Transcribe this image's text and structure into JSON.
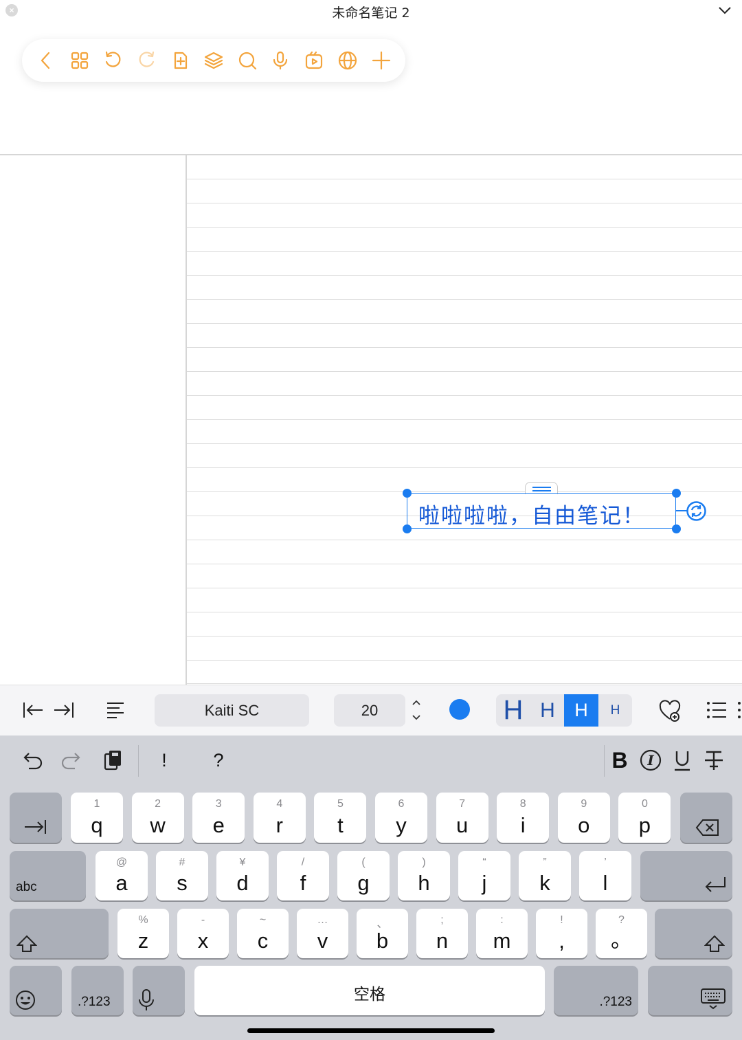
{
  "window": {
    "title": "未命名笔记 2"
  },
  "toolbar": {
    "icons": [
      "back-icon",
      "grid-icon",
      "undo-icon",
      "redo-icon",
      "add-page-icon",
      "layers-icon",
      "search-icon",
      "mic-icon",
      "media-icon",
      "globe-icon",
      "plus-icon"
    ],
    "accent": "#f3a43c"
  },
  "note": {
    "textbox_text": "啦啦啦啦，自由笔记！",
    "text_color": "#1559d6",
    "selection_color": "#1a7cf0"
  },
  "format_bar": {
    "font_name": "Kaiti SC",
    "font_size": "20",
    "heading_options": [
      {
        "label": "H",
        "size": 40,
        "active": false
      },
      {
        "label": "H",
        "size": 30,
        "active": false
      },
      {
        "label": "H",
        "size": 27,
        "active": true
      },
      {
        "label": "H",
        "size": 19,
        "active": false
      }
    ],
    "color": "#1a7cf0"
  },
  "keyboard": {
    "top_row": {
      "exclaim": "!",
      "question": "?"
    },
    "row1": [
      {
        "sub": "1",
        "main": "q"
      },
      {
        "sub": "2",
        "main": "w"
      },
      {
        "sub": "3",
        "main": "e"
      },
      {
        "sub": "4",
        "main": "r"
      },
      {
        "sub": "5",
        "main": "t"
      },
      {
        "sub": "6",
        "main": "y"
      },
      {
        "sub": "7",
        "main": "u"
      },
      {
        "sub": "8",
        "main": "i"
      },
      {
        "sub": "9",
        "main": "o"
      },
      {
        "sub": "0",
        "main": "p"
      }
    ],
    "row2": [
      {
        "sub": "@",
        "main": "a"
      },
      {
        "sub": "#",
        "main": "s"
      },
      {
        "sub": "¥",
        "main": "d"
      },
      {
        "sub": "/",
        "main": "f"
      },
      {
        "sub": "(",
        "main": "g"
      },
      {
        "sub": ")",
        "main": "h"
      },
      {
        "sub": "“",
        "main": "j"
      },
      {
        "sub": "”",
        "main": "k"
      },
      {
        "sub": "’",
        "main": "l"
      }
    ],
    "row3": [
      {
        "sub": "%",
        "main": "z"
      },
      {
        "sub": "-",
        "main": "x"
      },
      {
        "sub": "~",
        "main": "c"
      },
      {
        "sub": "…",
        "main": "v"
      },
      {
        "sub": "、",
        "main": "b"
      },
      {
        "sub": ";",
        "main": "n"
      },
      {
        "sub": ":",
        "main": "m"
      },
      {
        "sub": "!",
        "main": ","
      },
      {
        "sub": "?",
        "main": "。"
      }
    ],
    "abc_label": "abc",
    "num_label_left": ".?123",
    "num_label_right": ".?123",
    "space_label": "空格"
  }
}
